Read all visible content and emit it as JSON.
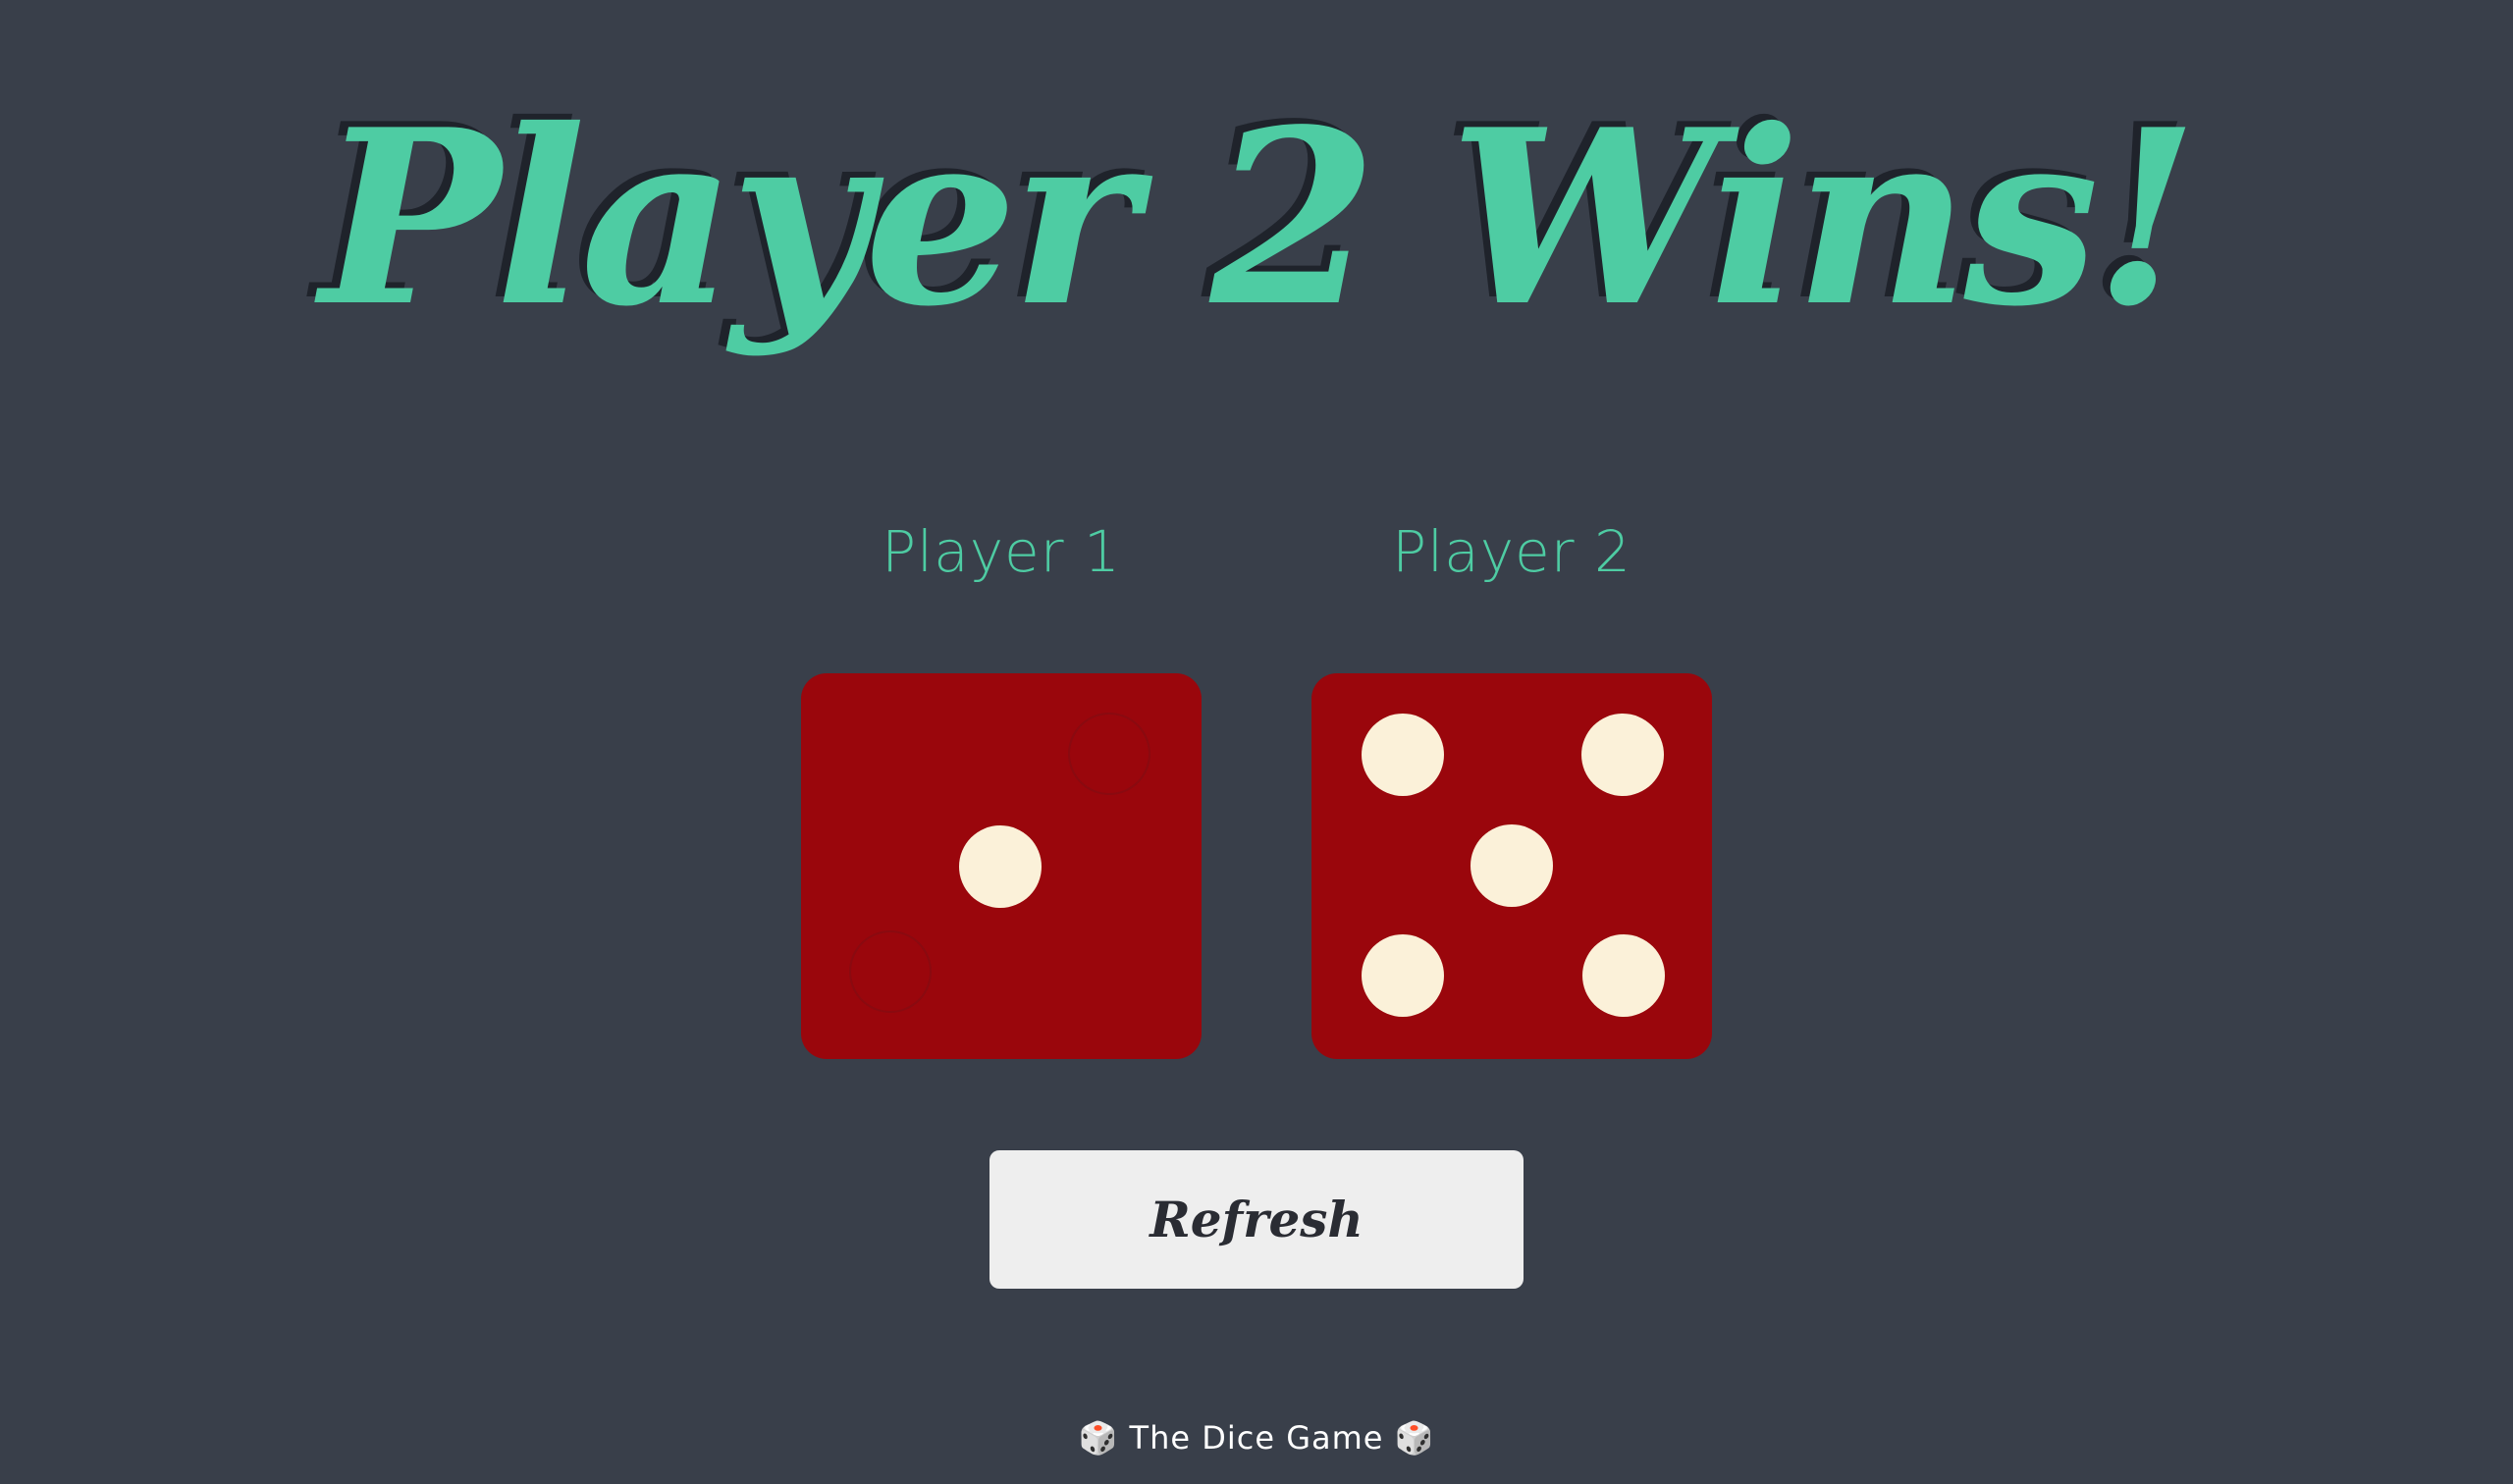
{
  "header": {
    "title": "Player 2 Wins!"
  },
  "players": [
    {
      "label": "Player 1",
      "die_value": 1
    },
    {
      "label": "Player 2",
      "die_value": 5
    }
  ],
  "controls": {
    "refresh_label": "Refresh"
  },
  "footer": {
    "text": "🎲 The Dice Game 🎲"
  },
  "colors": {
    "background": "#393f4a",
    "accent": "#4ecca3",
    "die_face": "#9a060c",
    "pip": "#fbf1d9",
    "button": "#eeeeee"
  }
}
